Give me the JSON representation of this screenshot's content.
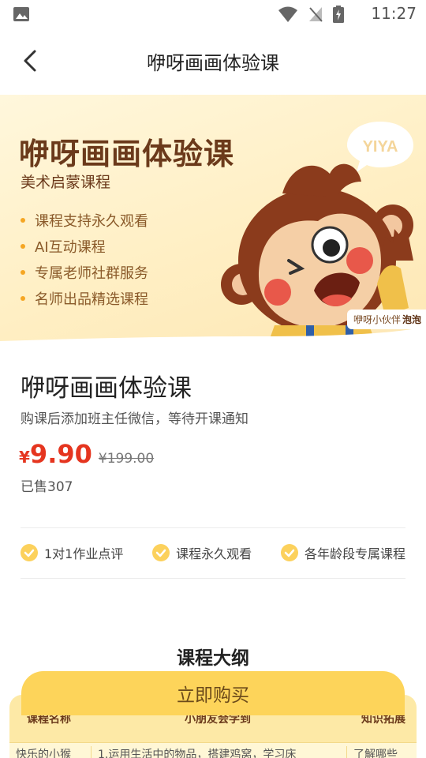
{
  "status_bar": {
    "time": "11:27"
  },
  "nav": {
    "title": "咿呀画画体验课"
  },
  "banner": {
    "title": "咿呀画画体验课",
    "subtitle": "美术启蒙课程",
    "bullets": [
      "课程支持永久观看",
      "AI互动课程",
      "专属老师社群服务",
      "名师出品精选课程"
    ],
    "bubble_text": "YIYA",
    "caption_prefix": "咿呀小伙伴",
    "caption_name": "泡泡"
  },
  "course": {
    "title": "咿呀画画体验课",
    "description": "购课后添加班主任微信，等待开课通知",
    "currency": "¥",
    "price": "9.90",
    "original_price": "¥199.00",
    "sold": "已售307"
  },
  "features": [
    "1对1作业点评",
    "课程永久观看",
    "各年龄段专属课程"
  ],
  "outline": {
    "title": "课程大纲",
    "headers": [
      "课程名称",
      "小朋友会学到",
      "知识拓展"
    ],
    "first_row": [
      "快乐的小猴",
      "1.运用生活中的物品，搭建鸡窝，学习床",
      "了解哪些"
    ]
  },
  "buy_button": {
    "label": "立即购买"
  },
  "colors": {
    "accent": "#fdd45a",
    "price": "#e5351f",
    "brown": "#6b3a1b"
  }
}
